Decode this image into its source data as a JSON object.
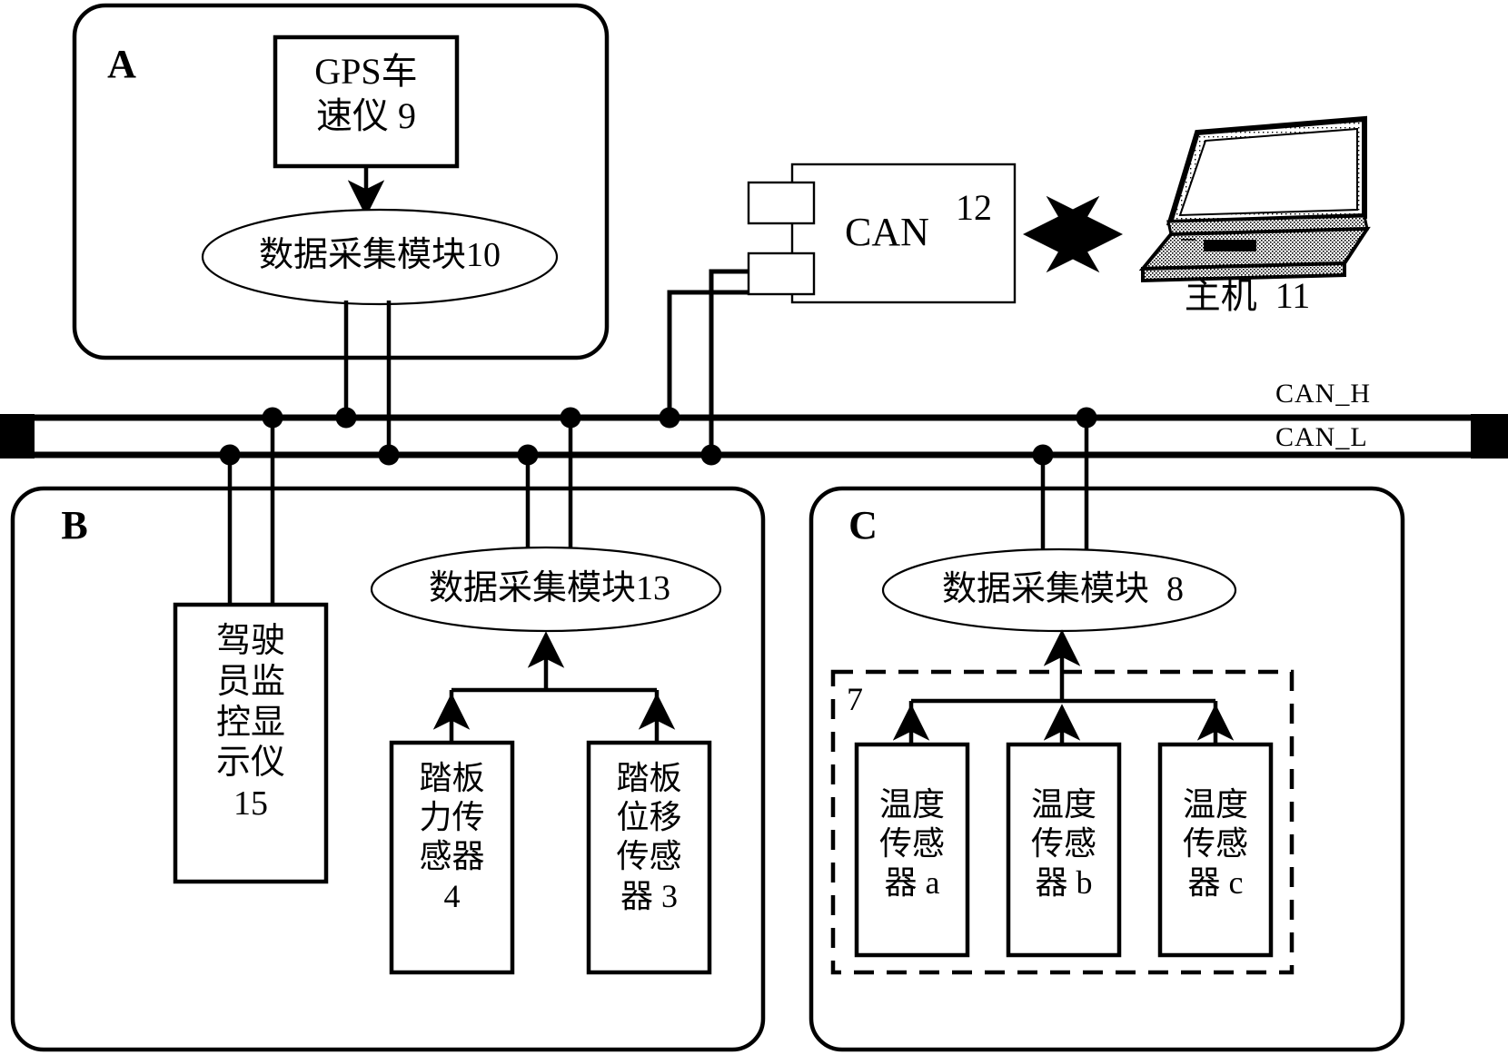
{
  "diagram": {
    "title": "Vehicle CAN bus data acquisition system block diagram",
    "groups": {
      "a": "A",
      "b": "B",
      "c": "C"
    },
    "bus": {
      "can_h": "CAN_H",
      "can_l": "CAN_L"
    },
    "group_a": {
      "gps_box": "GPS车\n速仪 9",
      "daq_module": "数据采集模块10"
    },
    "can_unit": {
      "label": "CAN",
      "number": "12"
    },
    "host": {
      "label": "主机  11",
      "icon": "laptop-icon"
    },
    "group_b": {
      "display_unit": "驾驶\n员监\n控显\n示仪\n15",
      "daq_module": "数据采集模块13",
      "sensors": [
        {
          "name": "踏板\n力传\n感器\n4"
        },
        {
          "name": "踏板\n位移\n传感\n器 3"
        }
      ]
    },
    "group_c": {
      "daq_module": "数据采集模块  8",
      "dashed_group_number": "7",
      "sensors": [
        {
          "name": "温度\n传感\n器 a"
        },
        {
          "name": "温度\n传感\n器 b"
        },
        {
          "name": "温度\n传感\n器 c"
        }
      ]
    },
    "colors": {
      "stroke": "#000000",
      "background": "#ffffff",
      "fill": "#ffffff"
    }
  }
}
